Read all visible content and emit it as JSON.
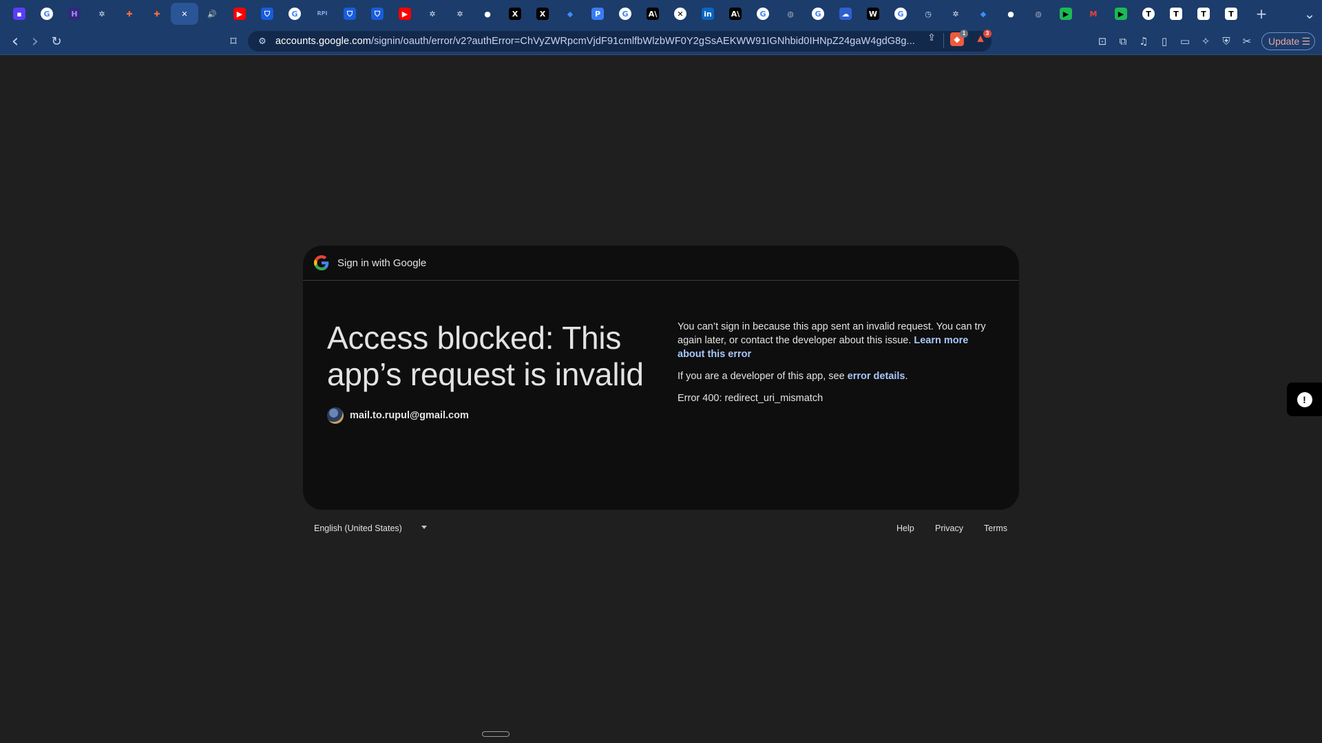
{
  "browser": {
    "tabs": [
      {
        "icon": "brave-gradient-icon",
        "glyph": "▪",
        "bg": "#5b3df5",
        "fg": "#ffffff"
      },
      {
        "icon": "google-icon",
        "glyph": "G",
        "bg": "#ffffff",
        "fg": "#4285f4"
      },
      {
        "icon": "h-logo-icon",
        "glyph": "H",
        "bg": "#2f2a7a",
        "fg": "#a58cff"
      },
      {
        "icon": "openai-icon",
        "glyph": "✲",
        "bg": "transparent",
        "fg": "#d6e0f0"
      },
      {
        "icon": "zapier-icon",
        "glyph": "✚",
        "bg": "transparent",
        "fg": "#ff6a3d"
      },
      {
        "icon": "zapier-icon",
        "glyph": "✚",
        "bg": "transparent",
        "fg": "#ff6a3d"
      },
      {
        "icon": "close-icon",
        "glyph": "✕",
        "bg": "transparent",
        "fg": "#ffffff"
      },
      {
        "icon": "speaker-icon",
        "glyph": "🔊",
        "bg": "transparent",
        "fg": "#ffffff"
      },
      {
        "icon": "youtube-icon",
        "glyph": "▶",
        "bg": "#ff0000",
        "fg": "#ffffff"
      },
      {
        "icon": "bitwarden-icon",
        "glyph": "⛉",
        "bg": "#175ddc",
        "fg": "#ffffff"
      },
      {
        "icon": "google-icon",
        "glyph": "G",
        "bg": "#ffffff",
        "fg": "#4285f4"
      },
      {
        "icon": "rpi-icon",
        "glyph": "RPI",
        "bg": "transparent",
        "fg": "#7fa8e6"
      },
      {
        "icon": "bitwarden-icon",
        "glyph": "⛉",
        "bg": "#175ddc",
        "fg": "#ffffff"
      },
      {
        "icon": "bitwarden-icon",
        "glyph": "⛉",
        "bg": "#175ddc",
        "fg": "#ffffff"
      },
      {
        "icon": "youtube-icon",
        "glyph": "▶",
        "bg": "#ff0000",
        "fg": "#ffffff"
      },
      {
        "icon": "openai-icon",
        "glyph": "✲",
        "bg": "transparent",
        "fg": "#d6e0f0"
      },
      {
        "icon": "openai-icon",
        "glyph": "✲",
        "bg": "transparent",
        "fg": "#d6e0f0"
      },
      {
        "icon": "github-icon",
        "glyph": "●",
        "bg": "transparent",
        "fg": "#ffffff"
      },
      {
        "icon": "x-icon",
        "glyph": "X",
        "bg": "#000000",
        "fg": "#ffffff"
      },
      {
        "icon": "x-icon",
        "glyph": "X",
        "bg": "#000000",
        "fg": "#ffffff"
      },
      {
        "icon": "bluesky-icon",
        "glyph": "◆",
        "bg": "transparent",
        "fg": "#3a8ff5"
      },
      {
        "icon": "p-logo-icon",
        "glyph": "P",
        "bg": "#3a7cf5",
        "fg": "#ffffff"
      },
      {
        "icon": "google-icon",
        "glyph": "G",
        "bg": "#ffffff",
        "fg": "#4285f4"
      },
      {
        "icon": "anthropic-icon",
        "glyph": "A\\",
        "bg": "#000000",
        "fg": "#ffffff"
      },
      {
        "icon": "x-circle-icon",
        "glyph": "✕",
        "bg": "#ffffff",
        "fg": "#000000"
      },
      {
        "icon": "linkedin-icon",
        "glyph": "in",
        "bg": "#0a66c2",
        "fg": "#ffffff"
      },
      {
        "icon": "anthropic-icon",
        "glyph": "A\\",
        "bg": "#000000",
        "fg": "#ffffff"
      },
      {
        "icon": "google-icon",
        "glyph": "G",
        "bg": "#ffffff",
        "fg": "#4285f4"
      },
      {
        "icon": "globe-icon",
        "glyph": "◍",
        "bg": "transparent",
        "fg": "#9aa5b5"
      },
      {
        "icon": "google-icon",
        "glyph": "G",
        "bg": "#ffffff",
        "fg": "#4285f4"
      },
      {
        "icon": "cloud-icon",
        "glyph": "☁",
        "bg": "#2f5fd0",
        "fg": "#ffffff"
      },
      {
        "icon": "wikipedia-icon",
        "glyph": "W",
        "bg": "#000000",
        "fg": "#ffffff"
      },
      {
        "icon": "google-icon",
        "glyph": "G",
        "bg": "#ffffff",
        "fg": "#4285f4"
      },
      {
        "icon": "clock-icon",
        "glyph": "◷",
        "bg": "transparent",
        "fg": "#d6e0f0"
      },
      {
        "icon": "openai-icon",
        "glyph": "✲",
        "bg": "transparent",
        "fg": "#d6e0f0"
      },
      {
        "icon": "bluesky-icon",
        "glyph": "◆",
        "bg": "transparent",
        "fg": "#3a8ff5"
      },
      {
        "icon": "github-icon",
        "glyph": "●",
        "bg": "transparent",
        "fg": "#ffffff"
      },
      {
        "icon": "globe-icon",
        "glyph": "◍",
        "bg": "transparent",
        "fg": "#9aa5b5"
      },
      {
        "icon": "green-play-icon",
        "glyph": "▶",
        "bg": "#1db954",
        "fg": "#000000"
      },
      {
        "icon": "gmail-icon",
        "glyph": "M",
        "bg": "transparent",
        "fg": "#ea4335"
      },
      {
        "icon": "green-play-icon",
        "glyph": "▶",
        "bg": "#1db954",
        "fg": "#000000"
      },
      {
        "icon": "t-circle-icon",
        "glyph": "T",
        "bg": "#ffffff",
        "fg": "#000000"
      },
      {
        "icon": "t-square-icon",
        "glyph": "T",
        "bg": "#ffffff",
        "fg": "#000000"
      },
      {
        "icon": "t-square-icon",
        "glyph": "T",
        "bg": "#ffffff",
        "fg": "#000000"
      },
      {
        "icon": "t-square-icon",
        "glyph": "T",
        "bg": "#ffffff",
        "fg": "#000000"
      }
    ],
    "active_tab_index": 6,
    "new_tab_glyph": "+",
    "tab_list_glyph": "⌄",
    "nav": {
      "back": "‹",
      "forward": "›",
      "reload": "↻",
      "bookmark": "⌑"
    },
    "address": {
      "site_icon": "⚙",
      "host": "accounts.google.com",
      "path": "/signin/oauth/error/v2?authError=ChVyZWRpcmVjdF91cmlfbWlzbWF0Y2gSsAEKWW91IGNhbid0IHNpZ24gaW4gdG8g...",
      "share": "⇪"
    },
    "shields_badge": "1",
    "rewards_badge": "3",
    "update_label": "Update",
    "menu_glyph": "☰",
    "extensions": [
      {
        "name": "reader-mode-icon",
        "glyph": "⊡"
      },
      {
        "name": "extensions-icon",
        "glyph": "⧉"
      },
      {
        "name": "media-icon",
        "glyph": "♫"
      },
      {
        "name": "sidebar-icon",
        "glyph": "▯"
      },
      {
        "name": "wallet-icon",
        "glyph": "▭"
      },
      {
        "name": "leo-ai-icon",
        "glyph": "✧"
      },
      {
        "name": "vpn-icon",
        "glyph": "⛨"
      },
      {
        "name": "tools-icon",
        "glyph": "✂"
      }
    ]
  },
  "card": {
    "header_title": "Sign in with Google",
    "headline": "Access blocked: This app’s request is invalid",
    "email": "mail.to.rupul@gmail.com",
    "para1_text": "You can’t sign in because this app sent an invalid request. You can try again later, or contact the developer about this issue. ",
    "para1_link": "Learn more about this error",
    "para2_text": "If you are a developer of this app, see ",
    "para2_link": "error details",
    "para2_end": ".",
    "error_code": "Error 400: redirect_uri_mismatch"
  },
  "footer": {
    "language": "English (United States)",
    "help": "Help",
    "privacy": "Privacy",
    "terms": "Terms"
  },
  "colors": {
    "tab_bar": "#1c3c6b",
    "page_bg": "#1f1f1f",
    "card_bg": "#0e0e0e",
    "link": "#a8c7fa"
  }
}
